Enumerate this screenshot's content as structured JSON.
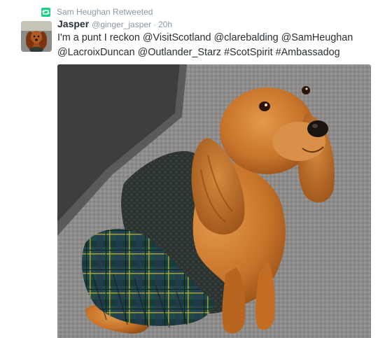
{
  "retweet": {
    "icon": "retweet-icon",
    "label": "Sam Heughan Retweeted"
  },
  "tweet": {
    "avatar_icon": "dog-avatar-icon",
    "name": "Jasper",
    "handle": "@ginger_jasper",
    "separator": "·",
    "time": "20h",
    "text_line1": "I'm a punt I reckon @VisitScotland @clarebalding @SamHeughan",
    "text_line2": "@LacroixDuncan @Outlander_Starz #ScotSpirit #Ambassadog"
  },
  "media": {
    "icon": "dog-in-kilt-photo",
    "colors": {
      "carpet": "#8e8c8a",
      "wall": "#3e3e40",
      "fur": "#c8732a",
      "tartan": "#1f4a45",
      "knit": "#2b3230"
    }
  },
  "colors": {
    "retweet_green": "#19cf86",
    "muted_text": "#8899a6",
    "body_text": "#292f33"
  }
}
